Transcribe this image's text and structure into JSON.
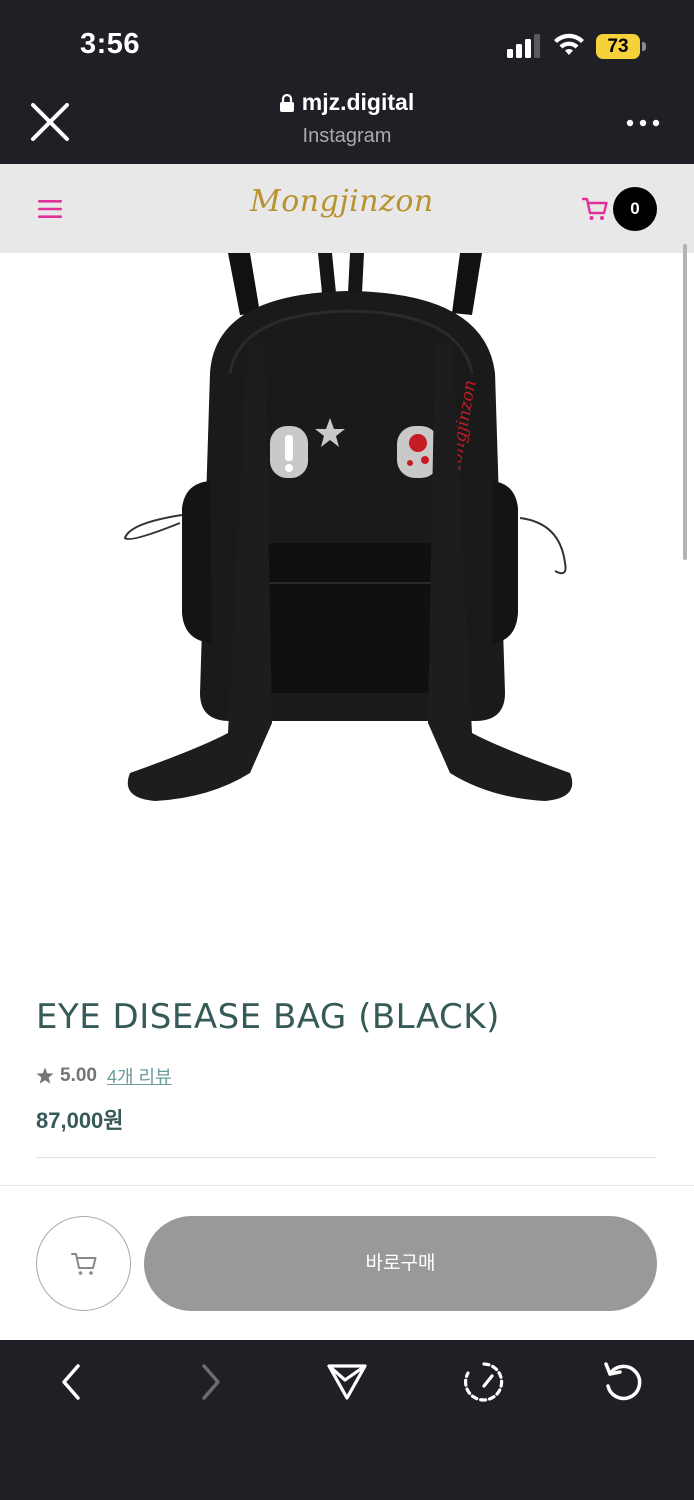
{
  "status_bar": {
    "time": "3:56",
    "battery": "73"
  },
  "browser": {
    "url": "mjz.digital",
    "source": "Instagram"
  },
  "site": {
    "logo": "Mongjinzon",
    "cart_count": "0"
  },
  "product": {
    "title": "EYE DISEASE BAG (BLACK)",
    "rating": "5.00",
    "reviews_link": "4개 리뷰",
    "price": "87,000원",
    "brand_on_bag": "Mongjinzon"
  },
  "actions": {
    "buy_now_label": "바로구매"
  },
  "colors": {
    "accent_pink": "#e0309a",
    "title_teal": "#355a58",
    "logo_gold": "#b8922e"
  }
}
